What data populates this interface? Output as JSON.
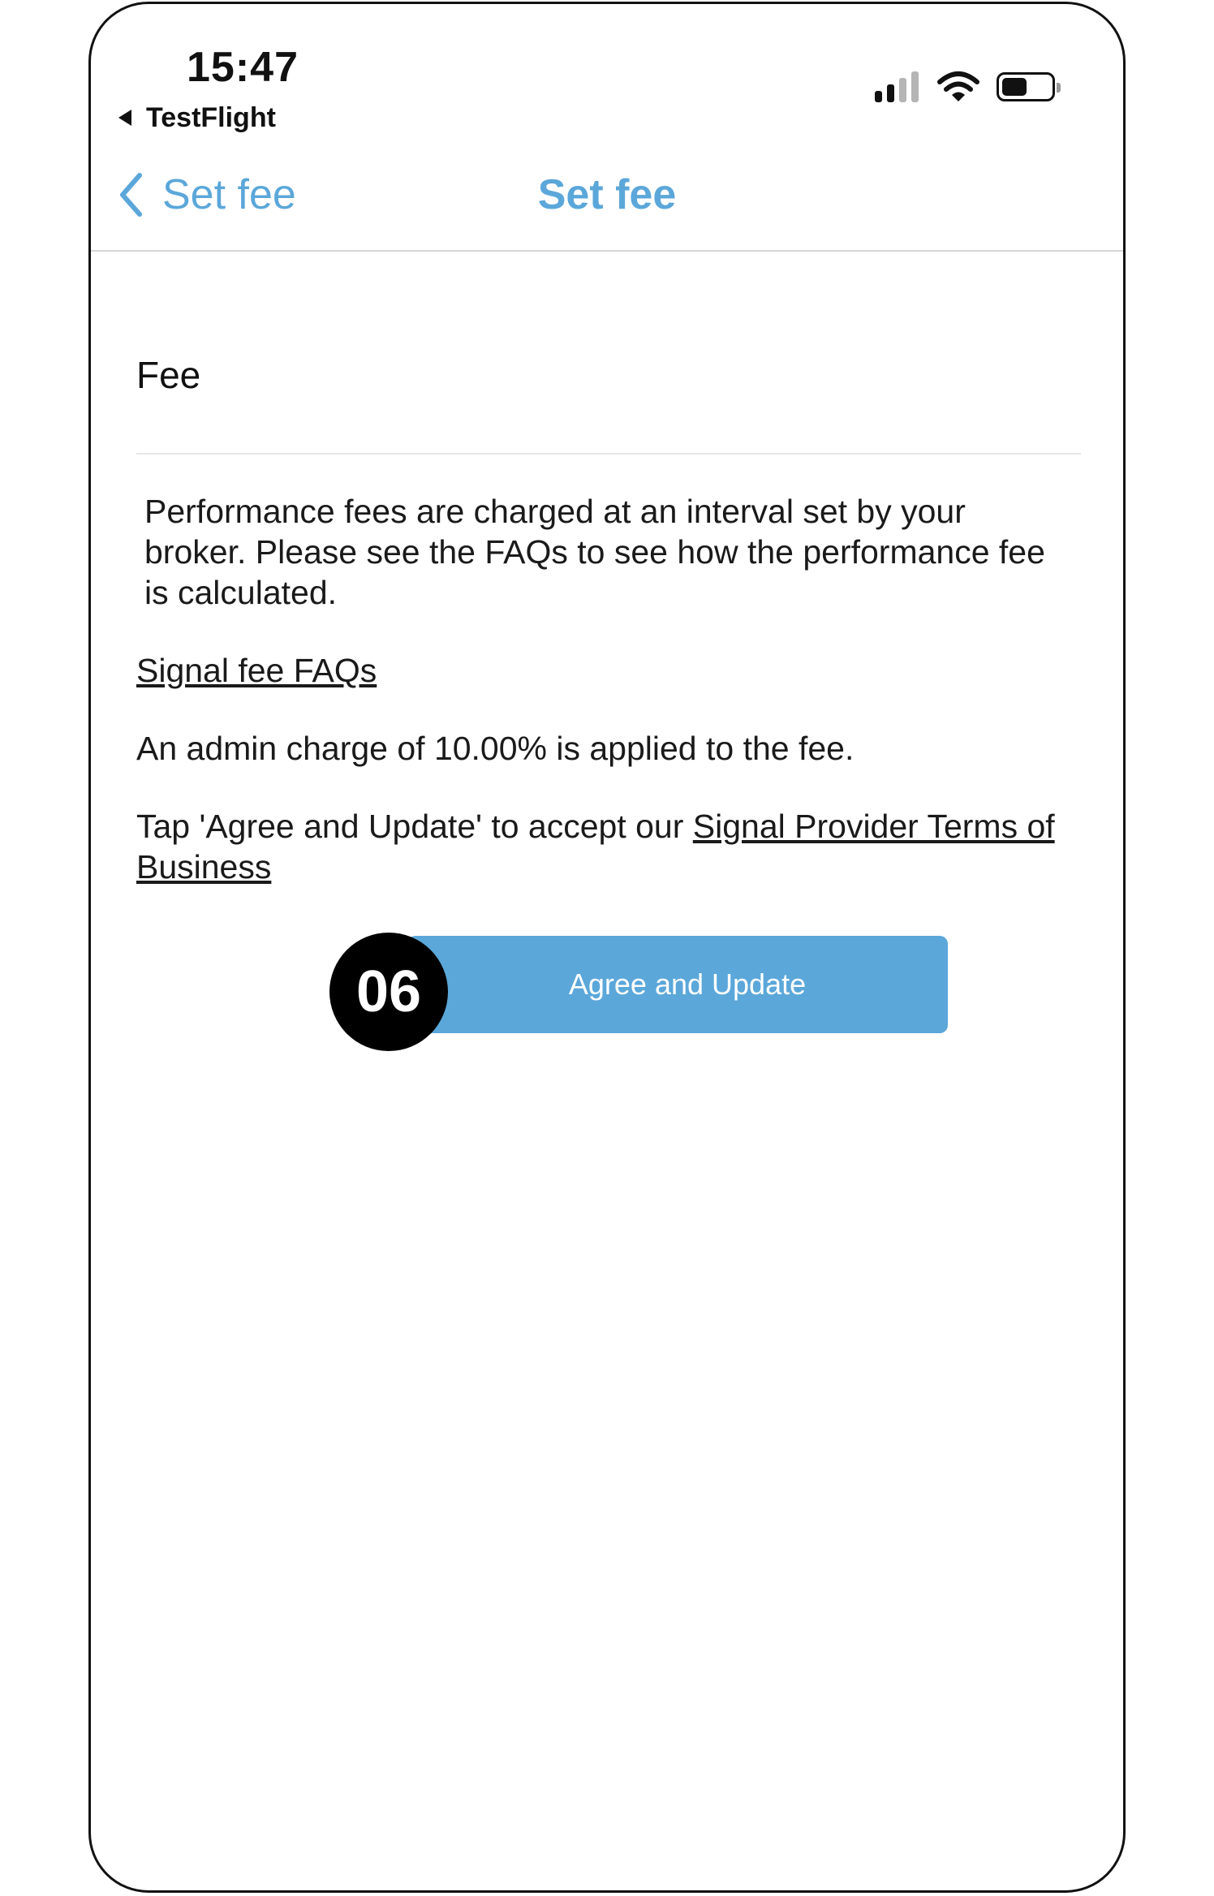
{
  "status_bar": {
    "time": "15:47",
    "back_app_label": "TestFlight",
    "icons": [
      "cellular-signal-icon",
      "wifi-icon",
      "battery-icon"
    ],
    "signal_bars_active": 2,
    "signal_bars_total": 4,
    "battery_level": 0.5
  },
  "nav": {
    "back_label": "Set fee",
    "title": "Set fee",
    "accent_color": "#5ba7da"
  },
  "content": {
    "fee_label": "Fee",
    "description": "Performance fees are charged at an interval set by your broker. Please see the FAQs to see how the performance fee is calculated.",
    "faq_link": "Signal fee FAQs",
    "admin_note": "An admin charge of 10.00% is applied to the fee.",
    "terms_prefix": "Tap 'Agree and Update' to accept our ",
    "terms_link": "Signal Provider Terms of Business"
  },
  "actions": {
    "agree_label": "Agree and Update",
    "step_badge": "06"
  }
}
